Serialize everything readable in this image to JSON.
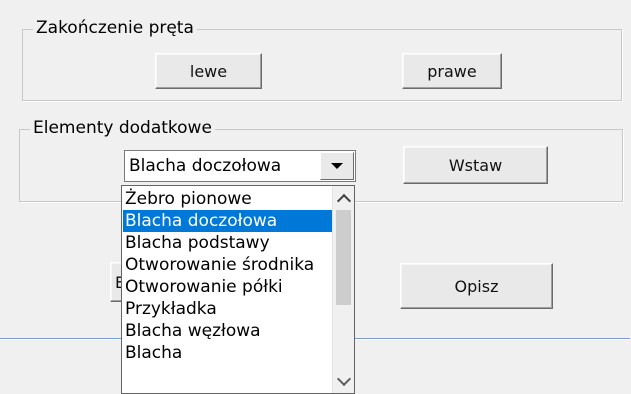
{
  "group_end": {
    "title": "Zakończenie pręta",
    "left_button": "lewe",
    "right_button": "prawe"
  },
  "group_additional": {
    "title": "Elementy dodatkowe",
    "combo_value": "Blacha doczołowa",
    "insert_button": "Wstaw"
  },
  "bottom": {
    "hidden_button_fragment": "E",
    "describe_button": "Opisz"
  },
  "dropdown": {
    "items": [
      "Żebro pionowe",
      "Blacha doczołowa",
      "Blacha podstawy",
      "Otworowanie środnika",
      "Otworowanie półki",
      "Przykładka",
      "Blacha węzłowa",
      "Blacha"
    ],
    "selected_index": 1
  },
  "colors": {
    "selection": "#0078d7",
    "background": "#f0f0f0",
    "separator": "#7a9fcf"
  }
}
